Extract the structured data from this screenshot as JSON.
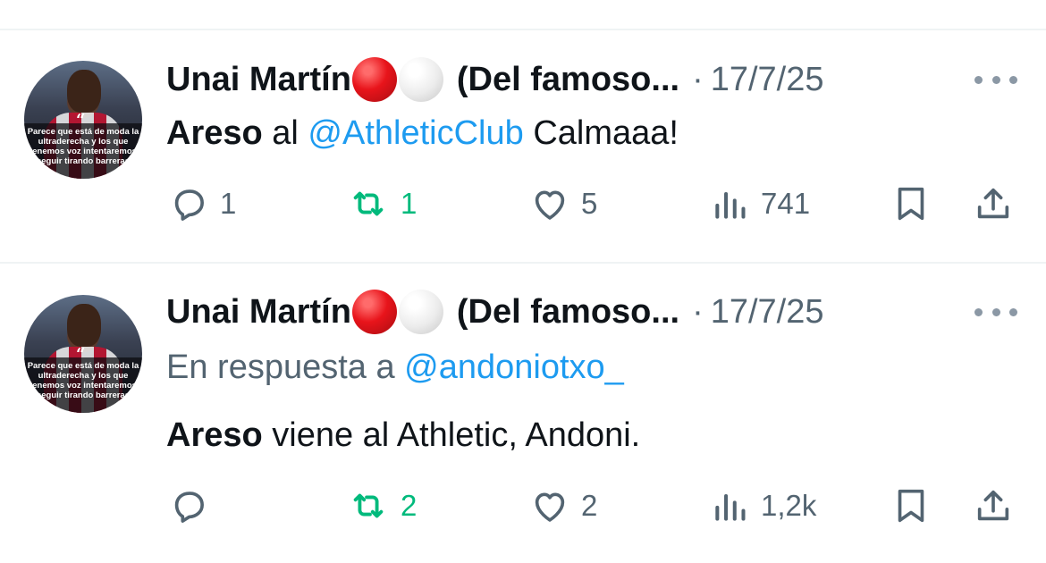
{
  "tweets": [
    {
      "author_name": "Unai Martín",
      "author_handle": "(Del famoso...",
      "date": "17/7/25",
      "separator": "·",
      "reply_to_prefix": "",
      "reply_to_mention": "",
      "body_bold": "Areso",
      "body_text_1": " al ",
      "body_mention": "@AthleticClub",
      "body_text_2": " Calmaaa!",
      "replies": "1",
      "retweets": "1",
      "likes": "5",
      "views": "741",
      "avatar_quote": "Parece que está de moda la\nultraderecha y los que\ntenemos voz intentaremos\nseguir tirando barreras"
    },
    {
      "author_name": "Unai Martín",
      "author_handle": "(Del famoso...",
      "date": "17/7/25",
      "separator": "·",
      "reply_to_prefix": "En respuesta a ",
      "reply_to_mention": "@andoniotxo_",
      "body_bold": "Areso",
      "body_text_1": " viene al Athletic, Andoni.",
      "body_mention": "",
      "body_text_2": "",
      "replies": "",
      "retweets": "2",
      "likes": "2",
      "views": "1,2k",
      "avatar_quote": "Parece que está de moda la\nultraderecha y los que\ntenemos voz intentaremos\nseguir tirando barreras"
    }
  ],
  "icons": {
    "reply": "reply-icon",
    "retweet": "retweet-icon",
    "like": "heart-icon",
    "views": "views-icon",
    "bookmark": "bookmark-icon",
    "share": "share-icon",
    "more": "more-icon"
  },
  "colors": {
    "accent": "#1d9bf0",
    "retweet": "#00ba7c",
    "secondary_text": "#536471",
    "primary_text": "#0f1419",
    "flag_red": "#e8141b"
  }
}
